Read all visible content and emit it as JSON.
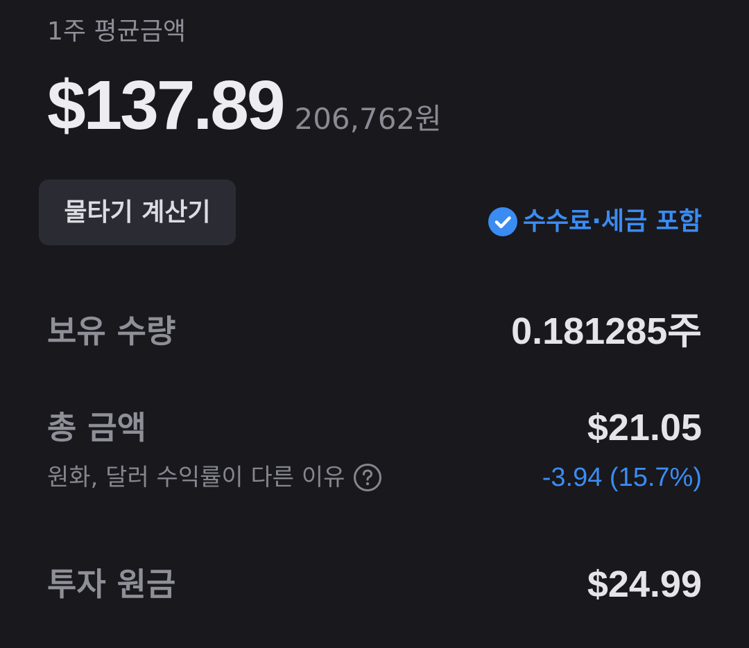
{
  "summary": {
    "avg_label": "1주 평균금액",
    "avg_price_usd": "$137.89",
    "avg_price_krw": "206,762원"
  },
  "actions": {
    "calc_button_label": "물타기 계산기"
  },
  "fee_badge": {
    "icon": "check-circle-icon",
    "label": "수수료·세금 포함",
    "color": "#3b8cf2"
  },
  "holdings": {
    "quantity_label": "보유 수량",
    "quantity_value": "0.181285주",
    "total_label": "총 금액",
    "total_value": "$21.05",
    "fx_note": "원화, 달러 수익률이 다른 이유",
    "fx_help_icon": "question-circle-icon",
    "change_value": "-3.94 (15.7%)",
    "change_color": "#3b8cf2",
    "principal_label": "투자 원금",
    "principal_value": "$24.99"
  }
}
